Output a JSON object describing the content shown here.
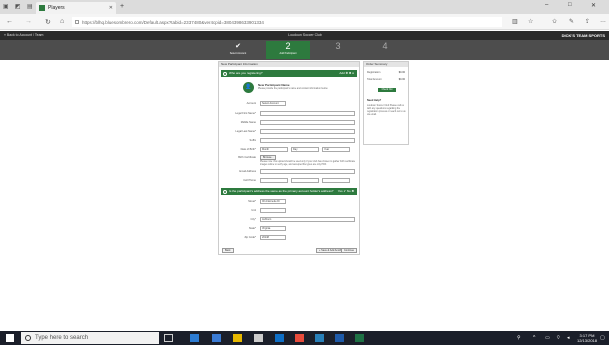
{
  "browser": {
    "tab_title": "Players",
    "tab_close": "✕",
    "new_tab": "+",
    "url": "https://blhq.bluesombrero.com/Default.aspx?tabid=2337480&ver4cpid=3804398633901334",
    "minimize": "–",
    "maximize": "□",
    "close": "✕"
  },
  "app": {
    "back_link": "« Back to Account / Team",
    "center_title": "Loudoun Soccer Club",
    "brand": "DICK'S TEAM SPORTS"
  },
  "steps": [
    {
      "n": "✔",
      "label": "Select Account"
    },
    {
      "n": "2",
      "label": "Add Participant"
    },
    {
      "n": "3",
      "label": ""
    },
    {
      "n": "4",
      "label": ""
    }
  ],
  "form": {
    "card_title": "New Participant Information",
    "section1_title": "Who are you registering?",
    "section1_right": "Add ✚ ✖ ●",
    "photo_icon": "👤",
    "participant_name_heading": "New Participant Name",
    "participant_name_note": "Please provide the participant's name and contact information below.",
    "fields": [
      {
        "label": "Account",
        "value": "Select Account"
      },
      {
        "label": "Legal First Name*",
        "value": ""
      },
      {
        "label": "Middle Name",
        "value": ""
      },
      {
        "label": "Legal Last Name*",
        "value": ""
      },
      {
        "label": "Suffix",
        "value": ""
      },
      {
        "label": "Date of Birth*",
        "value": ""
      },
      {
        "label": "Birth Certificate",
        "value": ""
      },
      {
        "label": "Email Address",
        "value": ""
      },
      {
        "label": "Cell Phone",
        "value": ""
      }
    ],
    "dob_month": "Month",
    "dob_day": "Day",
    "dob_year": "Year",
    "upload_button": "Browse...",
    "upload_note": "Please note: this upload should be used only if your club has chosen to gather birth certificate images online to verify age, and accepted file types are only PDF.",
    "section2_title": "Is the participant's address the same as the primary account holder's address?",
    "section2_right": "Yes ✔ No ✖",
    "address_fields": [
      {
        "label": "Street*",
        "value": "00 Antionette Dr"
      },
      {
        "label": "Unit",
        "value": ""
      },
      {
        "label": "City*",
        "value": "Ashburn"
      },
      {
        "label": "State*",
        "value": "Virginia"
      },
      {
        "label": "Zip Code*",
        "value": "20148"
      }
    ],
    "back_button": "Back",
    "save_button": "+ Save & Add Another",
    "continue_button": "Continue"
  },
  "summary": {
    "title": "Order Summary",
    "rows": [
      {
        "label": "Registration",
        "value": "$0.00"
      },
      {
        "label": "Total Amount",
        "value": "$0.00"
      }
    ],
    "button": "Check Out",
    "help_title": "Need Help?",
    "help_text": "Loudoun Soccer Club Please call us with any questions regarding the registration process or reach out to us via email."
  },
  "taskbar": {
    "search_placeholder": "Type here to search",
    "time": "3:17 PM",
    "date": "12/13/2018"
  },
  "colors": {
    "accent": "#2d7a3e",
    "header": "#2b2b2b",
    "steps": "#4d4d4d"
  }
}
